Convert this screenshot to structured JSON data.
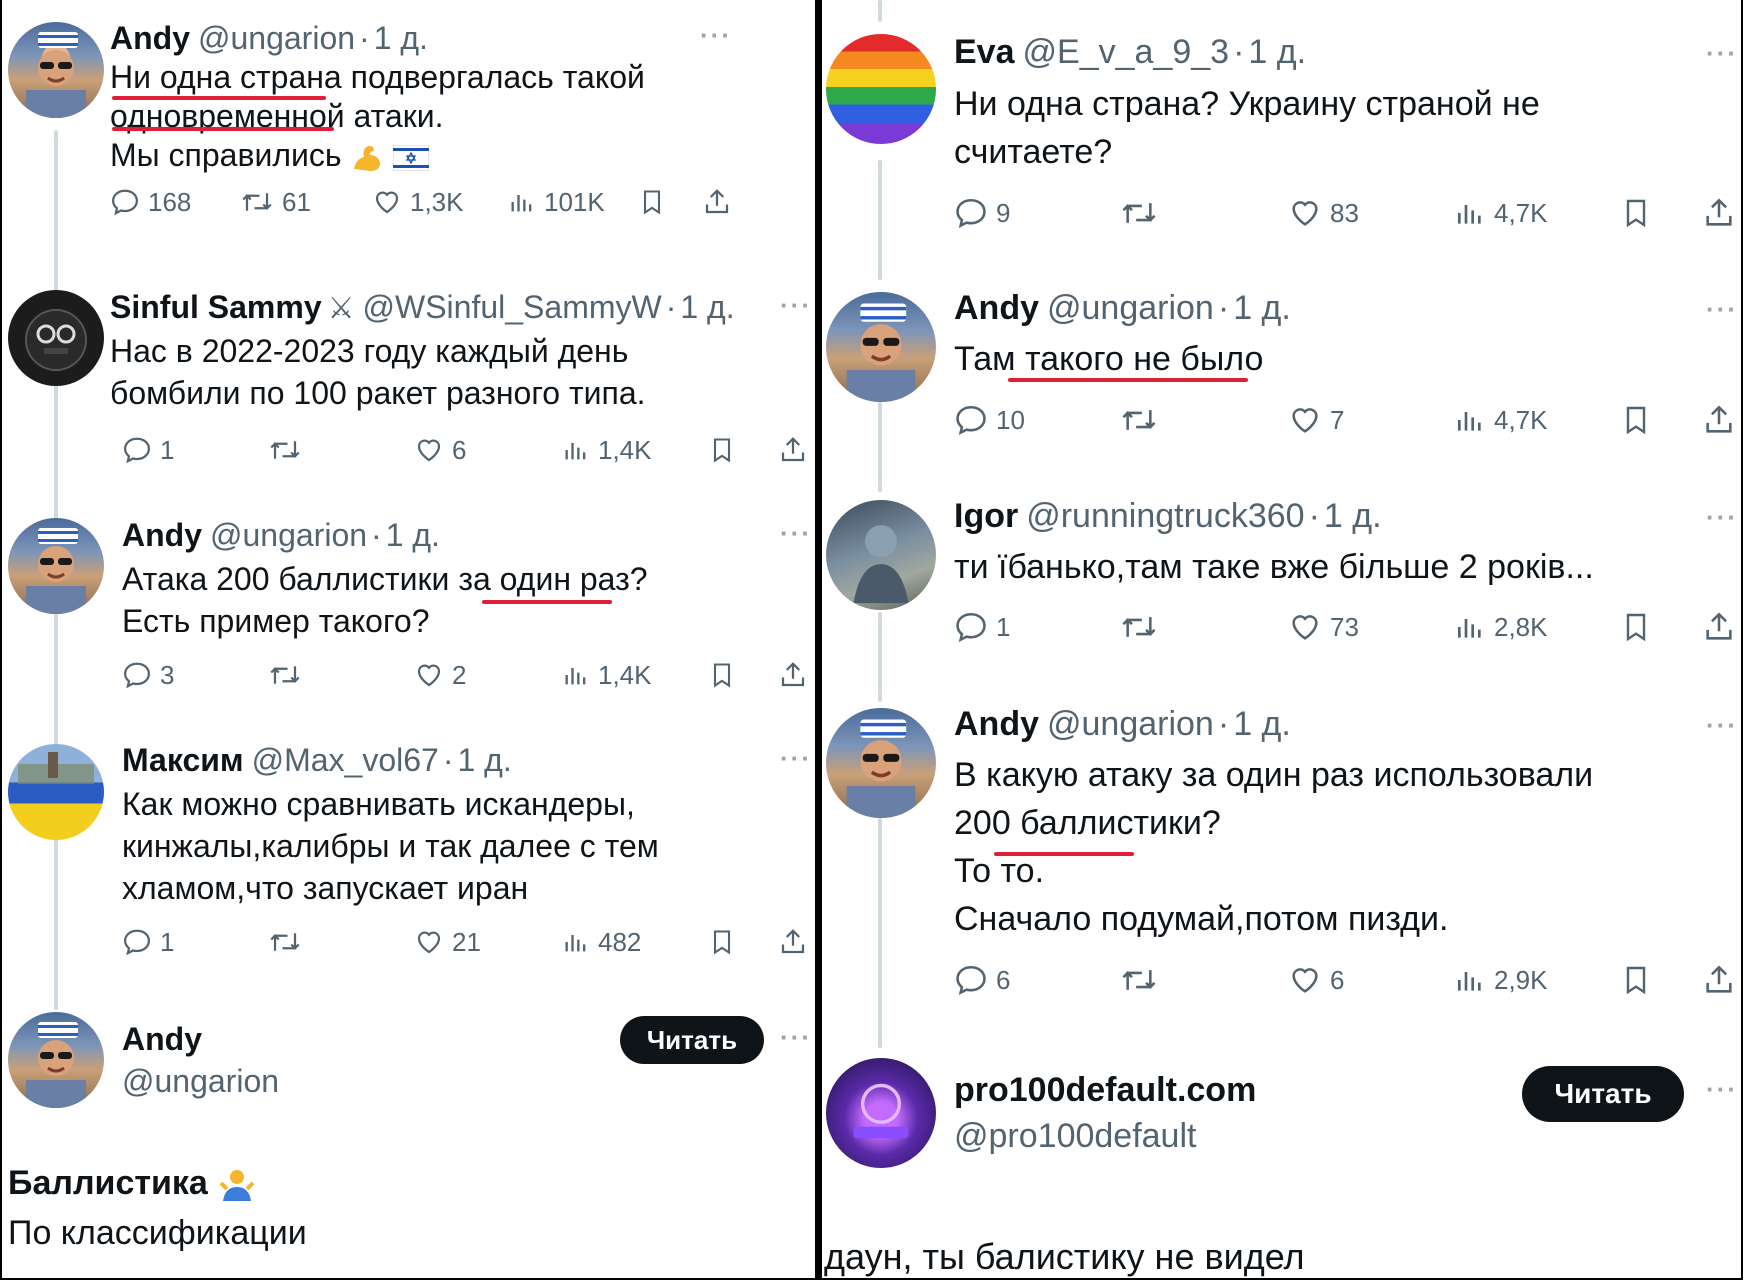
{
  "left": {
    "tweets": [
      {
        "name": "Andy",
        "handle": "@ungarion",
        "time": "1 д.",
        "lines": [
          "Ни одна страна подвергалась такой",
          "одновременной атаки.",
          "Мы справились"
        ],
        "replies": "168",
        "reposts": "61",
        "likes": "1,3K",
        "views": "101K"
      },
      {
        "name": "Sinful Sammy",
        "handle": "@WSinful_SammyW",
        "time": "1 д.",
        "lines": [
          "Нас в 2022-2023 году каждый день",
          "бомбили по 100 ракет разного типа."
        ],
        "replies": "1",
        "reposts": "",
        "likes": "6",
        "views": "1,4K"
      },
      {
        "name": "Andy",
        "handle": "@ungarion",
        "time": "1 д.",
        "lines": [
          "Атака 200 баллистики за один раз?",
          "Есть пример такого?"
        ],
        "replies": "3",
        "reposts": "",
        "likes": "2",
        "views": "1,4K"
      },
      {
        "name": "Максим",
        "handle": "@Max_vol67",
        "time": "1 д.",
        "lines": [
          "Как можно сравнивать искандеры,",
          "кинжалы,калибры и так далее с тем",
          "хламом,что запускает иран"
        ],
        "replies": "1",
        "reposts": "",
        "likes": "21",
        "views": "482"
      }
    ],
    "profile": {
      "name": "Andy",
      "handle": "@ungarion",
      "follow_label": "Читать"
    },
    "bottom_title": "Баллистика",
    "bottom_text": "По классификации"
  },
  "right": {
    "tweets": [
      {
        "name": "Eva",
        "handle": "@E_v_a_9_3",
        "time": "1 д.",
        "lines": [
          "Ни одна страна? Украину страной не",
          "считаете?"
        ],
        "replies": "9",
        "reposts": "",
        "likes": "83",
        "views": "4,7K"
      },
      {
        "name": "Andy",
        "handle": "@ungarion",
        "time": "1 д.",
        "lines": [
          "Там такого не было"
        ],
        "replies": "10",
        "reposts": "",
        "likes": "7",
        "views": "4,7K"
      },
      {
        "name": "Igor",
        "handle": "@runningtruck360",
        "time": "1 д.",
        "lines": [
          "ти їбанько,там таке вже більше 2 років..."
        ],
        "replies": "1",
        "reposts": "",
        "likes": "73",
        "views": "2,8K"
      },
      {
        "name": "Andy",
        "handle": "@ungarion",
        "time": "1 д.",
        "lines": [
          "В какую атаку за один раз использовали",
          "200 баллистики?",
          "То то.",
          "Сначало подумай,потом пизди."
        ],
        "replies": "6",
        "reposts": "",
        "likes": "6",
        "views": "2,9K"
      }
    ],
    "profile": {
      "name": "pro100default.com",
      "handle": "@pro100default",
      "follow_label": "Читать"
    },
    "bottom_text": "даун, ты балистику не видел"
  },
  "colors": {
    "underline": "#e0203a",
    "text": "#0f1419",
    "muted": "#536471",
    "button": "#0f1419"
  },
  "icons": [
    "reply-icon",
    "repost-icon",
    "like-icon",
    "views-icon",
    "bookmark-icon",
    "share-icon",
    "more-icon"
  ]
}
